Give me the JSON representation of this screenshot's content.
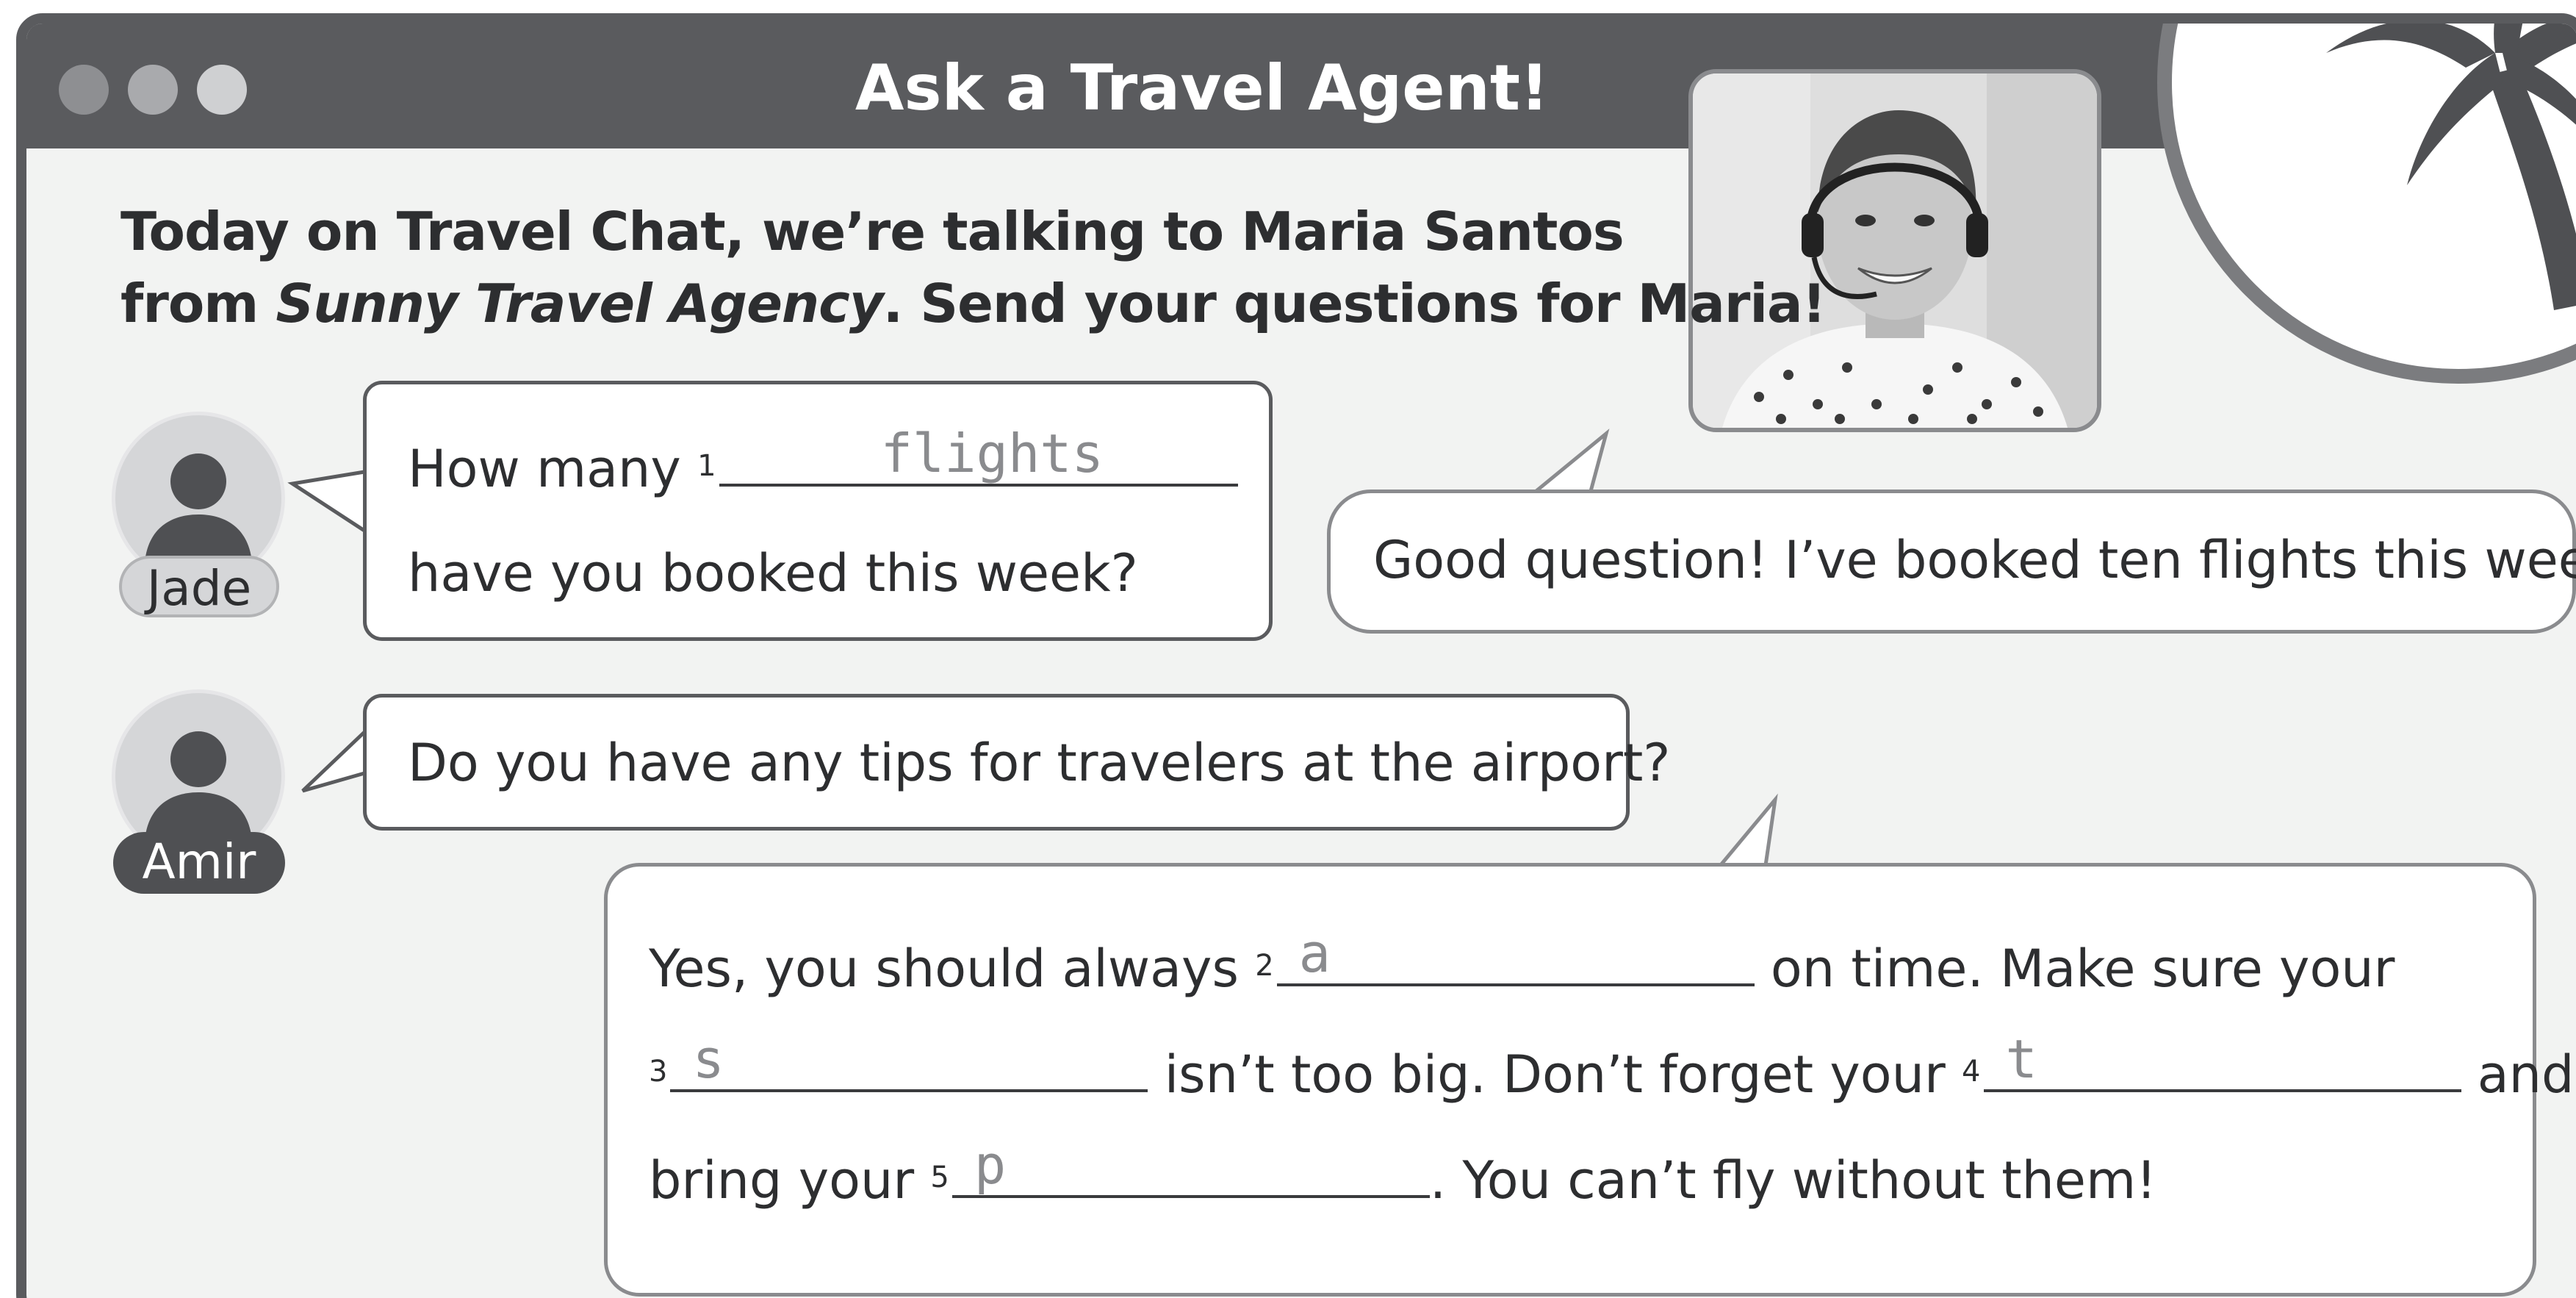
{
  "window": {
    "title": "Ask a Travel Agent!"
  },
  "intro": {
    "line1": "Today on Travel Chat, we’re talking to Maria Santos",
    "line2_from": "from ",
    "line2_agency": "Sunny Travel Agency",
    "line2_rest": ". Send your questions for Maria!"
  },
  "people": {
    "jade": "Jade",
    "amir": "Amir"
  },
  "jade_question": {
    "part1": "How many",
    "num": "1",
    "answer": "flights",
    "part2": "have you booked this week?"
  },
  "maria_reply1": {
    "text": "Good question! I’ve booked ten flights this week."
  },
  "amir_question": {
    "text": "Do you have any tips for travelers at the airport?"
  },
  "maria_reply2": {
    "l1_a": "Yes, you should always",
    "n2": "2",
    "a2": "a",
    "l1_b": "on time. Make sure your",
    "n3": "3",
    "a3": "s",
    "l2_a": "isn’t too big. Don’t forget your",
    "n4": "4",
    "a4": "t",
    "l2_b": "and",
    "l3_a": "bring your",
    "n5": "5",
    "a5": "p",
    "l3_b": ". You can’t fly without them!"
  },
  "colors": {
    "frame": "#5a5b5e",
    "background": "#f2f3f2",
    "answer_gray": "#8a8b8e"
  }
}
